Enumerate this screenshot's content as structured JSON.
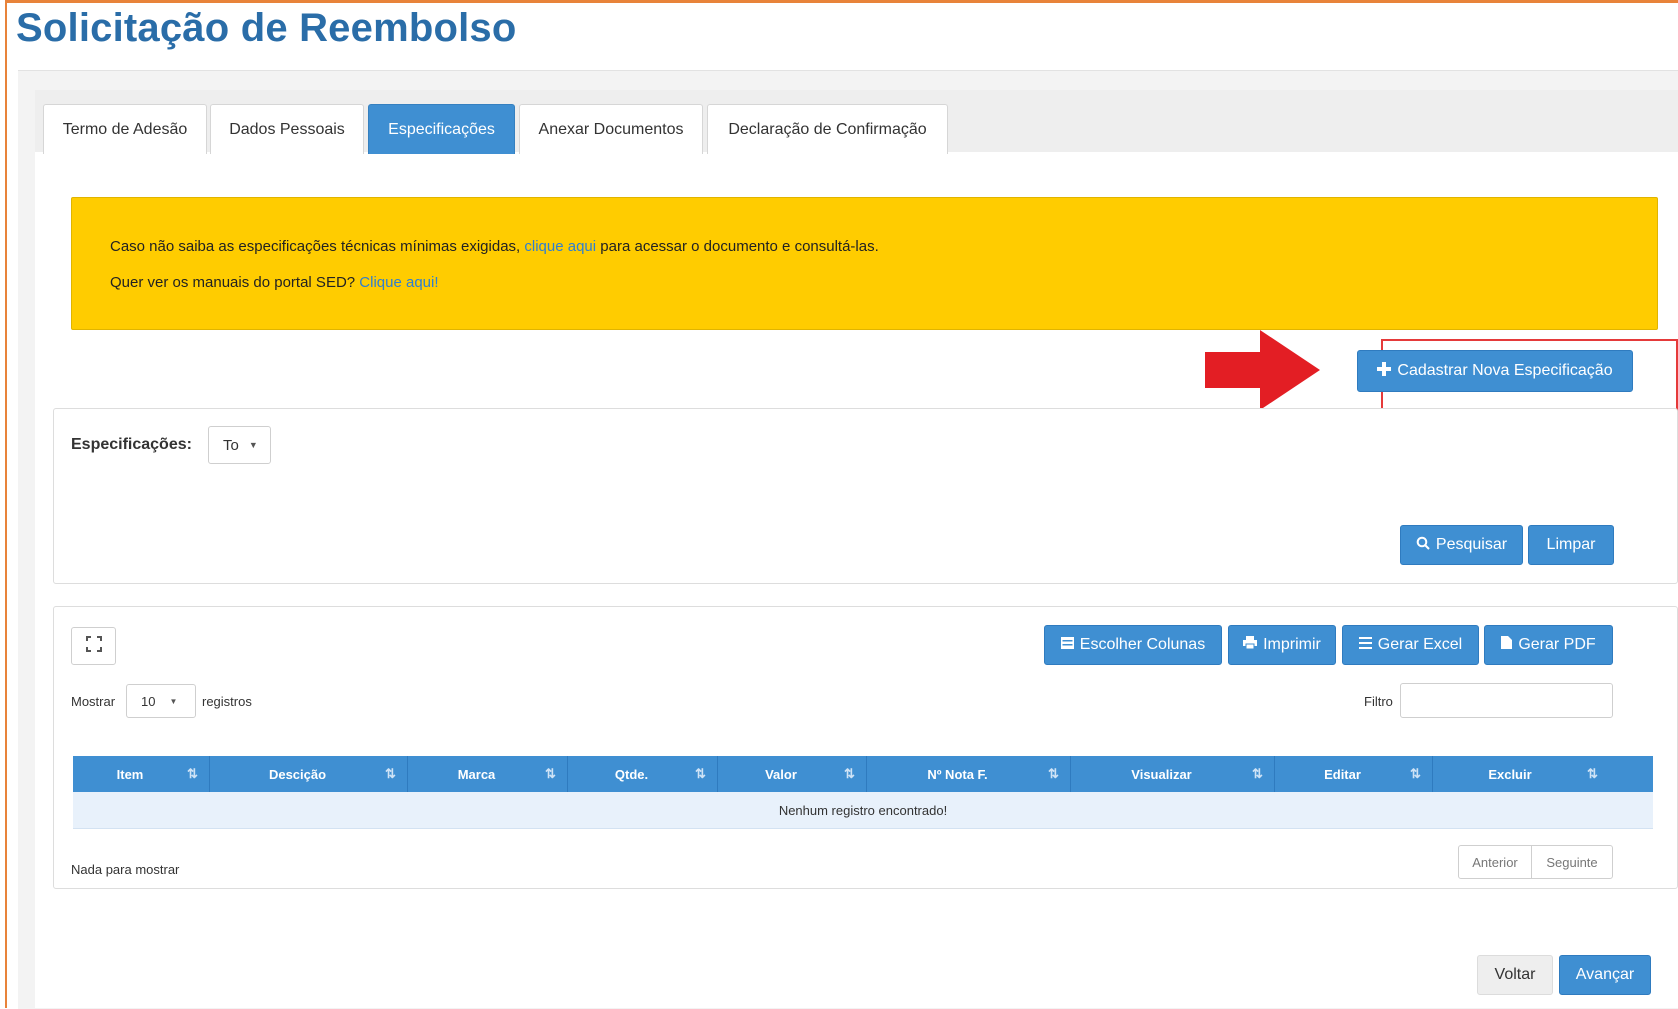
{
  "page": {
    "title": "Solicitação de Reembolso"
  },
  "tabs": [
    {
      "label": "Termo de Adesão",
      "active": false
    },
    {
      "label": "Dados Pessoais",
      "active": false
    },
    {
      "label": "Especificações",
      "active": true
    },
    {
      "label": "Anexar Documentos",
      "active": false
    },
    {
      "label": "Declaração de Confirmação",
      "active": false
    }
  ],
  "alert": {
    "line1_before": "Caso não saiba as especificações técnicas mínimas exigidas,",
    "line1_link": "clique aqui",
    "line1_after": "para acessar o documento e consultá-las.",
    "line2_before": "Quer ver os manuais do portal SED?",
    "line2_link": "Clique aqui!"
  },
  "new_spec_button": {
    "label": "Cadastrar Nova Especificação"
  },
  "filter": {
    "label": "Especificações:",
    "select_value": "To",
    "search_label": "Pesquisar",
    "clear_label": "Limpar"
  },
  "toolbar": {
    "choose_columns": "Escolher Colunas",
    "print": "Imprimir",
    "excel": "Gerar Excel",
    "pdf": "Gerar PDF"
  },
  "table_controls": {
    "show_label": "Mostrar",
    "page_size": "10",
    "records_label": "registros",
    "filter_label": "Filtro",
    "filter_value": ""
  },
  "table": {
    "columns": [
      "Item",
      "Descição",
      "Marca",
      "Qtde.",
      "Valor",
      "Nº Nota F.",
      "Visualizar",
      "Editar",
      "Excluir"
    ],
    "empty_message": "Nenhum registro encontrado!"
  },
  "pagination": {
    "info": "Nada para mostrar",
    "previous": "Anterior",
    "next": "Seguinte"
  },
  "footer": {
    "back": "Voltar",
    "next": "Avançar"
  },
  "colors": {
    "primary": "#3f8fd2",
    "alert": "#ffcc00",
    "title": "#2a6da8",
    "arrow": "#e31e24"
  },
  "icons": {
    "add": "plus-icon",
    "search": "search-icon",
    "expand": "expand-icon",
    "columns": "columns-icon",
    "print": "print-icon",
    "excel": "list-icon",
    "pdf": "file-icon",
    "sort": "sort-icon",
    "arrow": "red-arrow-icon"
  }
}
